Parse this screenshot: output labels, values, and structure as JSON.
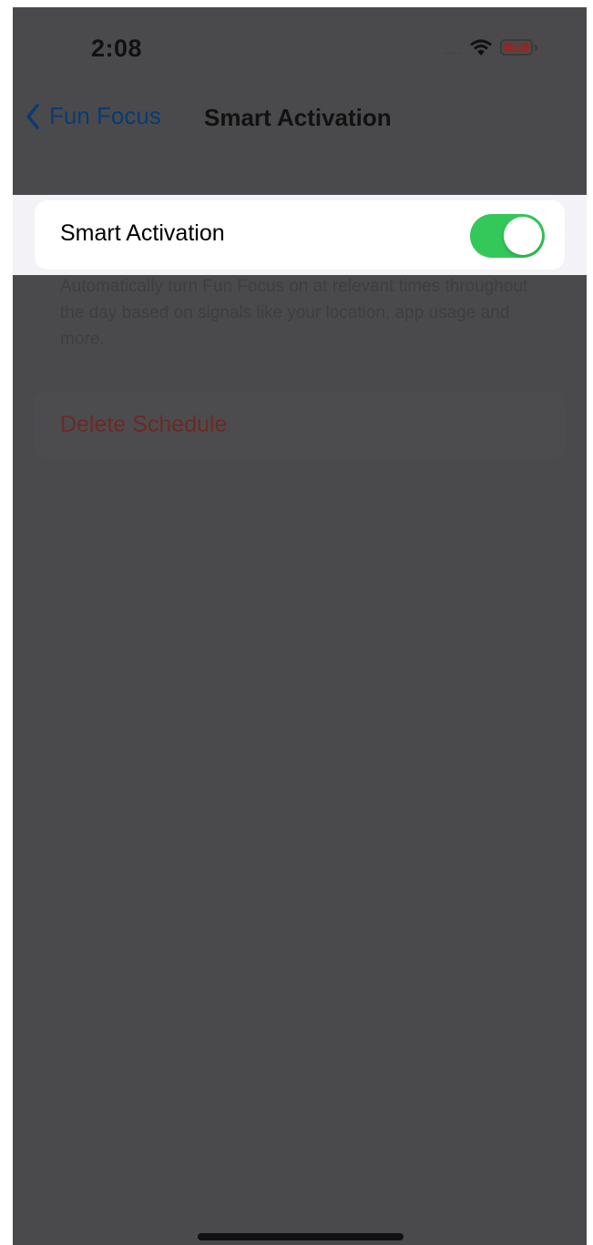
{
  "status_bar": {
    "time": "2:08",
    "signal": "....",
    "wifi_icon": "wifi-icon",
    "battery_level": "18",
    "battery_color": "#8e2a26"
  },
  "nav": {
    "back_label": "Fun Focus",
    "back_icon": "chevron-left-icon",
    "title": "Smart Activation"
  },
  "toggle_row": {
    "label": "Smart Activation",
    "enabled": true,
    "on_color": "#34c759"
  },
  "footer": {
    "text": "Automatically turn Fun Focus on at relevant times throughout the day based on signals like your location, app usage and more."
  },
  "delete": {
    "label": "Delete Schedule"
  },
  "colors": {
    "overlay": "#4a4a4c",
    "accent": "#0a84ff",
    "destructive": "#ff3b30"
  }
}
